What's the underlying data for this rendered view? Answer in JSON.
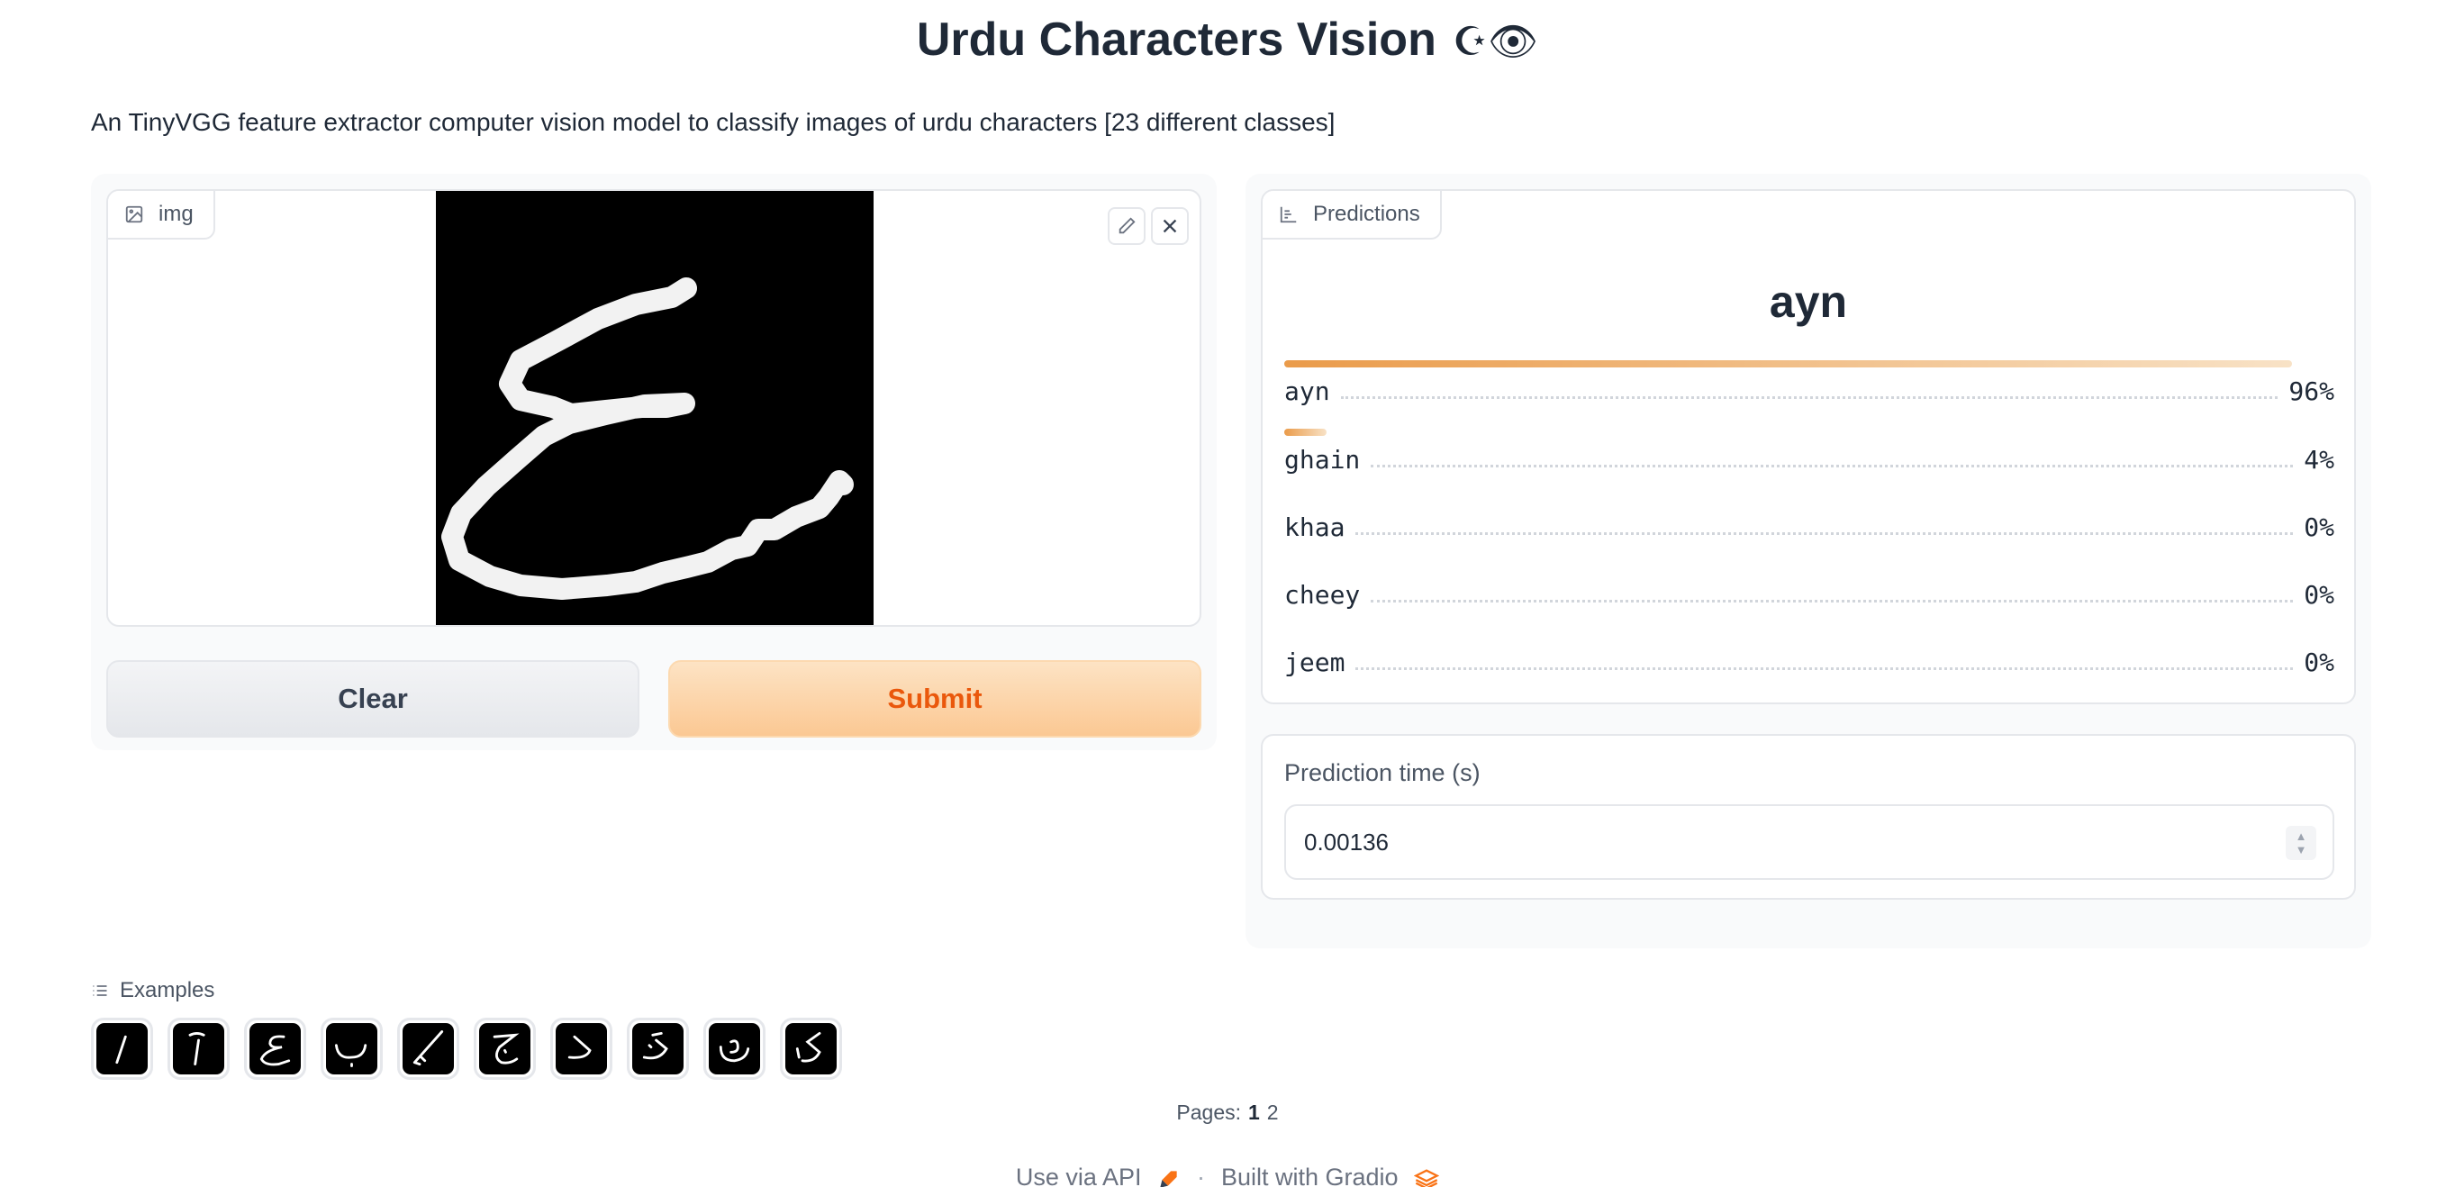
{
  "header": {
    "title": "Urdu Characters Vision",
    "title_emoji": "☪👁",
    "description": "An TinyVGG feature extractor computer vision model to classify images of urdu characters [23 different classes]"
  },
  "image_input": {
    "label": "img",
    "icon": "image-icon",
    "tools": [
      "edit-icon",
      "close-icon"
    ]
  },
  "buttons": {
    "clear_label": "Clear",
    "submit_label": "Submit"
  },
  "predictions": {
    "label": "Predictions",
    "icon": "bar-chart-icon",
    "top_label": "ayn",
    "confidences": [
      {
        "label": "ayn",
        "value": 0.96,
        "text": "96%"
      },
      {
        "label": "ghain",
        "value": 0.04,
        "text": "4%"
      },
      {
        "label": "khaa",
        "value": 0.0,
        "text": "0%"
      },
      {
        "label": "cheey",
        "value": 0.0,
        "text": "0%"
      },
      {
        "label": "jeem",
        "value": 0.0,
        "text": "0%"
      }
    ],
    "bar_color": "#ea9b4a"
  },
  "prediction_time": {
    "label": "Prediction time (s)",
    "value": "0.00136"
  },
  "examples": {
    "label": "Examples",
    "icon": "list-icon",
    "count": 10
  },
  "pagination": {
    "label": "Pages:",
    "current": "1",
    "next": "2"
  },
  "footer": {
    "api_text": "Use via API",
    "separator": "·",
    "built_text": "Built with Gradio"
  },
  "colors": {
    "accent": "#ea580c",
    "submit_bg": "#fbc893"
  }
}
